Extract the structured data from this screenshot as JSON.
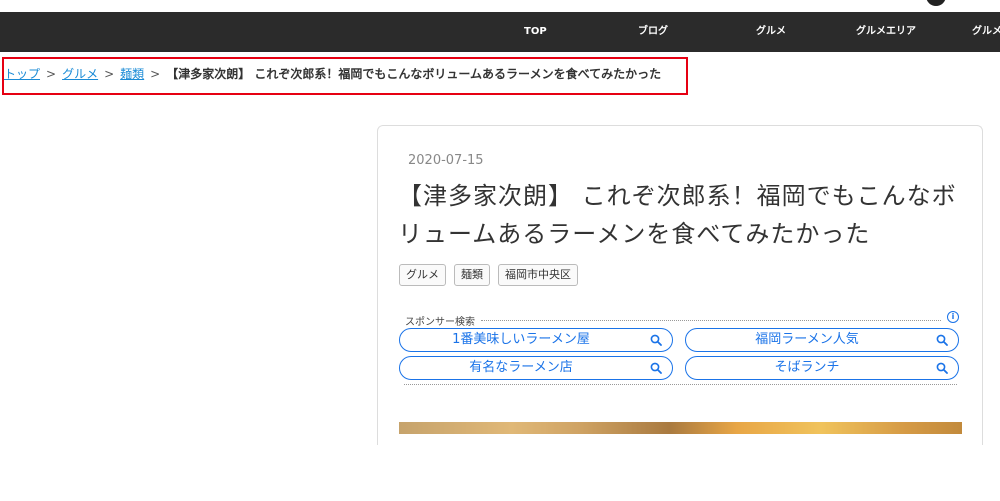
{
  "nav": {
    "items": [
      {
        "label": "TOP"
      },
      {
        "label": "ブログ"
      },
      {
        "label": "グルメ"
      },
      {
        "label": "グルメエリア"
      },
      {
        "label": "グルメ"
      }
    ]
  },
  "breadcrumb": {
    "links": [
      {
        "label": "トップ"
      },
      {
        "label": "グルメ"
      },
      {
        "label": "麺類"
      }
    ],
    "separator": ">",
    "current": "【津多家次朗】 これぞ次郎系！福岡でもこんなボリュームあるラーメンを食べてみたかった"
  },
  "article": {
    "date": "2020-07-15",
    "title": "【津多家次朗】 これぞ次郎系！福岡でもこんなボリュームあるラーメンを食べてみたかった",
    "tags": [
      {
        "label": "グルメ"
      },
      {
        "label": "麺類"
      },
      {
        "label": "福岡市中央区"
      }
    ]
  },
  "sponsor": {
    "label": "スポンサー検索",
    "info_icon": "i",
    "accent_color": "#1a73e8",
    "searches": [
      {
        "label": "1番美味しいラーメン屋",
        "icon": "search-icon"
      },
      {
        "label": "福岡ラーメン人気",
        "icon": "search-icon"
      },
      {
        "label": "有名なラーメン店",
        "icon": "search-icon"
      },
      {
        "label": "そばランチ",
        "icon": "search-icon"
      }
    ]
  },
  "colors": {
    "nav_background": "#2b2b2b",
    "breadcrumb_highlight": "#e60012",
    "link": "#1a8bd6"
  }
}
